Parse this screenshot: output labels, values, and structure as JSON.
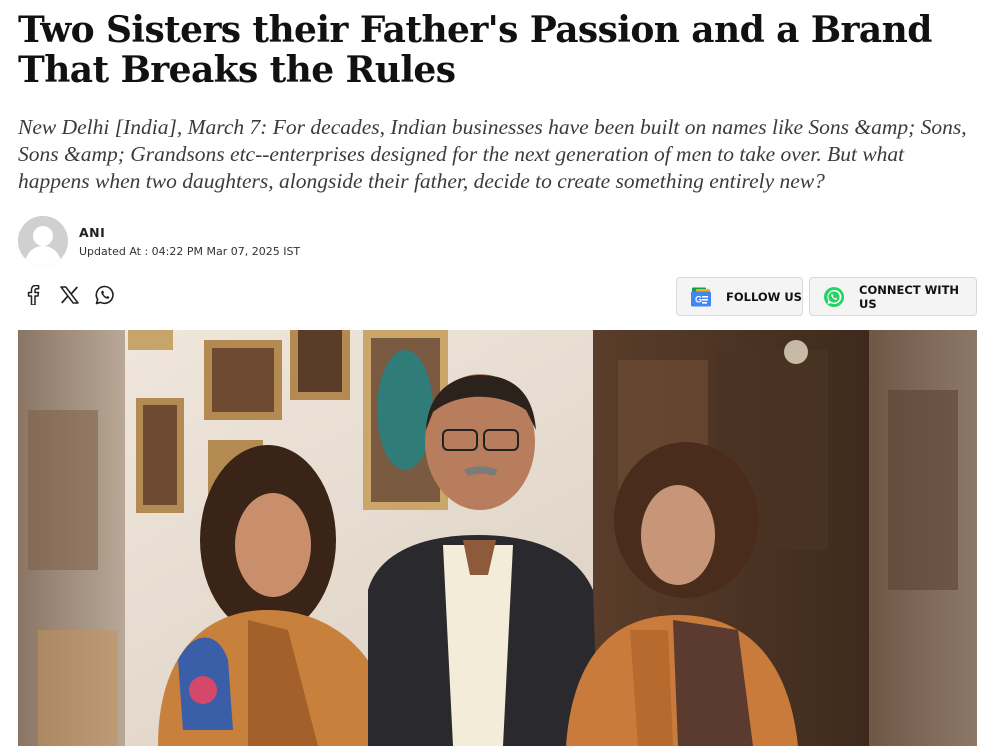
{
  "article": {
    "headline": "Two Sisters their Father's Passion and a Brand That Breaks the Rules",
    "summary": "New Delhi [India], March 7: For decades, Indian businesses have been built on names like Sons &amp; Sons, Sons &amp; Grandsons etc--enterprises designed for the next generation of men to take over. But what happens when two daughters, alongside their father, decide to create something entirely new?"
  },
  "author": {
    "name": "ANI",
    "updated": "Updated At : 04:22 PM Mar 07, 2025 IST"
  },
  "share": {
    "icons": [
      "facebook-icon",
      "x-icon",
      "whatsapp-icon"
    ]
  },
  "actions": {
    "follow_label": "FOLLOW US",
    "connect_label": "CONNECT WITH US"
  },
  "colors": {
    "whatsapp_green": "#25D366",
    "google_news_blue": "#4285F4"
  }
}
